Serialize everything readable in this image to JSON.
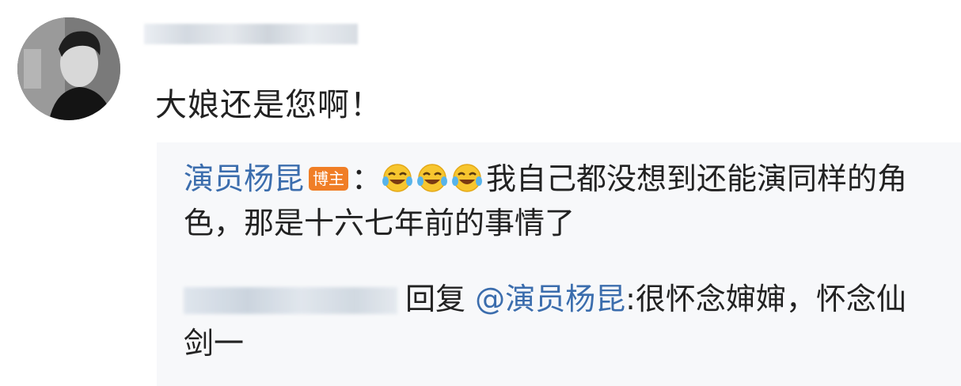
{
  "comment": {
    "text": "大娘还是您啊！"
  },
  "reply1": {
    "author": "演员杨昆",
    "badge": "博主",
    "separator": "：",
    "emoji": "laughing-crying-emoji",
    "text": "我自己都没想到还能演同样的角色，那是十六七年前的事情了"
  },
  "reply2": {
    "action": "回复",
    "mention": "@演员杨昆",
    "text": ":很怀念婶婶，怀念仙剑一"
  }
}
